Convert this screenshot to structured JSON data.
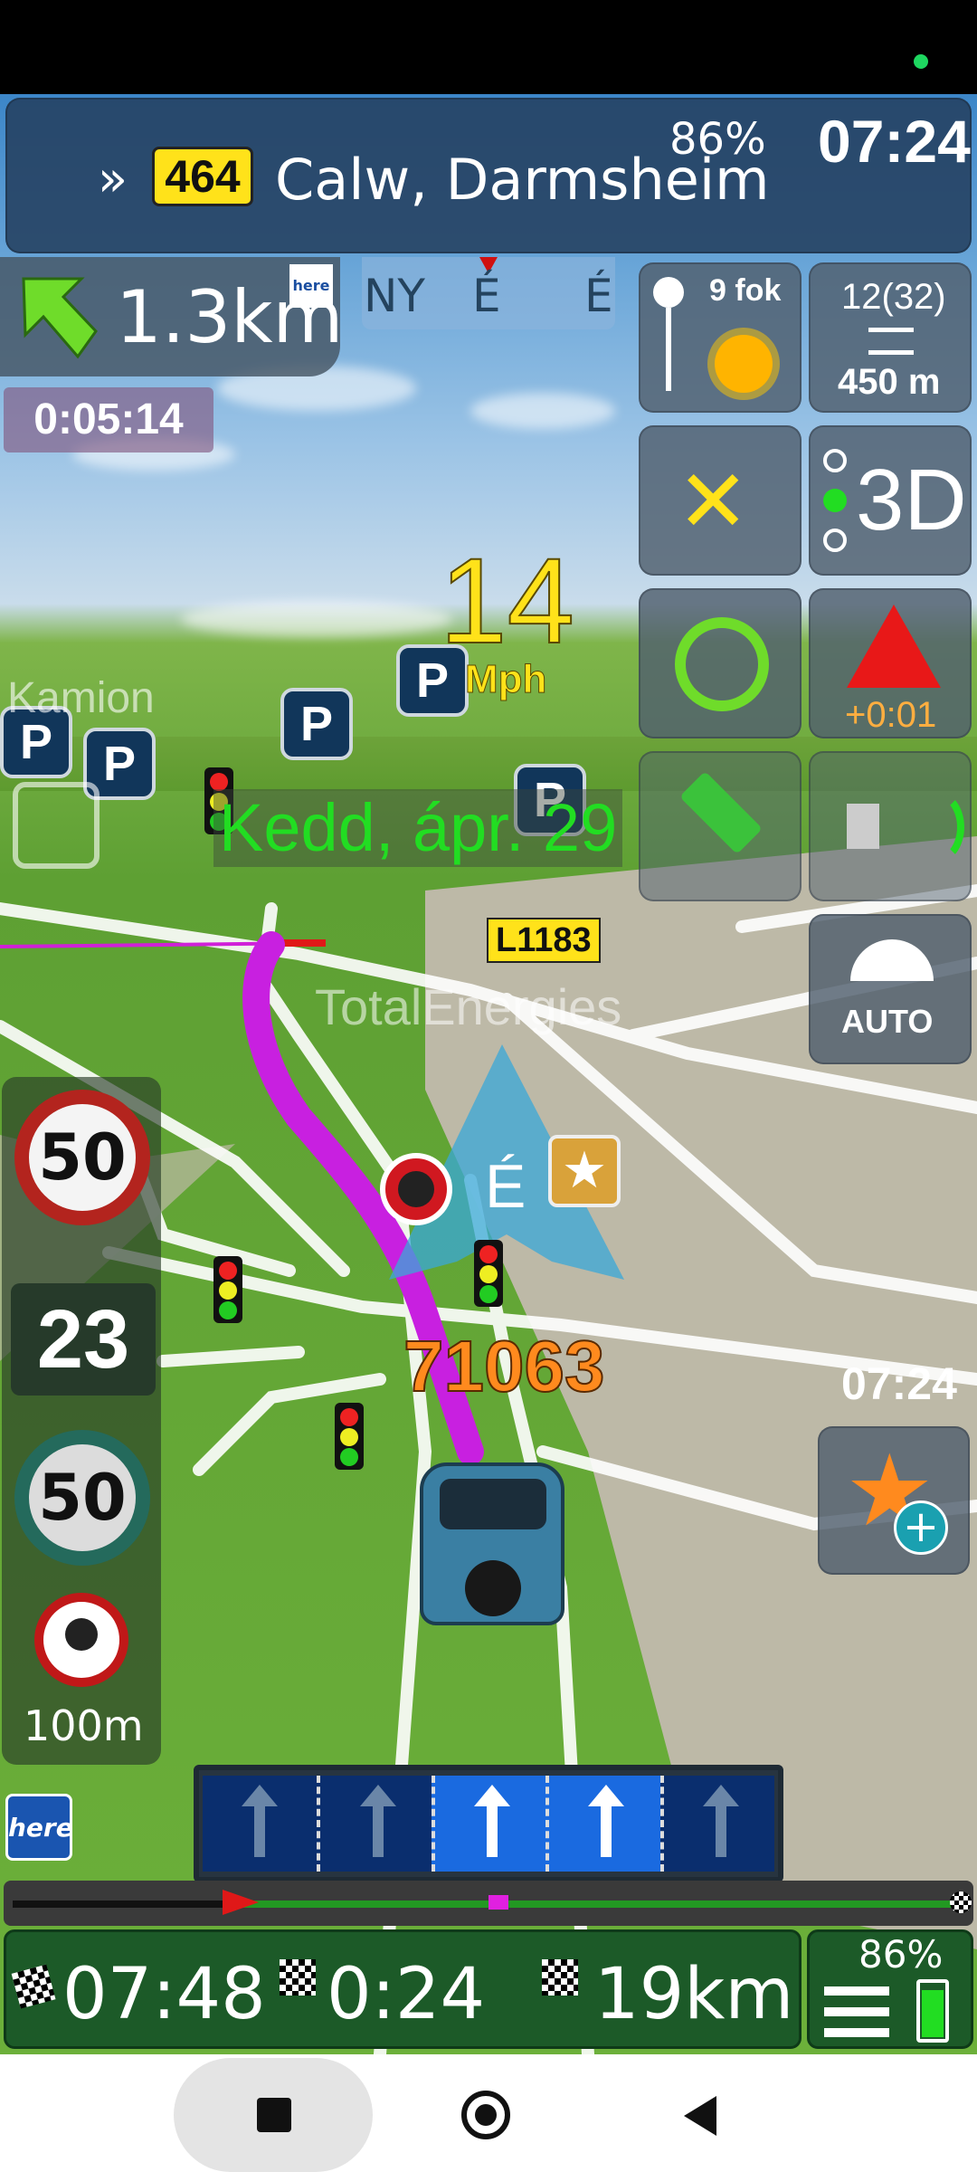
{
  "status_bar": {
    "indicator_color": "#1ed760"
  },
  "header": {
    "route_number": "464",
    "destination": "Calw, Darmsheim",
    "battery": "86%",
    "clock": "07:24"
  },
  "turn": {
    "distance": "1.3km",
    "provider_badge": "here"
  },
  "compass_strip": {
    "labels": [
      "NY",
      "É",
      "É"
    ]
  },
  "elapsed_time": "0:05:14",
  "weather": {
    "temperature": "9 fok"
  },
  "satellites": {
    "count": "12(32)",
    "altitude": "450 m"
  },
  "view_mode": {
    "label": "3D"
  },
  "hazard": {
    "delay": "+0:01"
  },
  "brightness": {
    "label": "AUTO"
  },
  "speed": {
    "value": "14",
    "unit": "Mph"
  },
  "map_labels": {
    "date": "Kedd, ápr. 29",
    "road_label": "L1183",
    "poi_label": "TotalEnergies",
    "truck_label": "Kamion",
    "heading_letter": "É",
    "house_number": "71063",
    "map_clock": "07:24"
  },
  "speed_panel": {
    "limit_1": "50",
    "current_speed": "23",
    "limit_2": "50",
    "camera_distance": "100m"
  },
  "provider_logo": "here",
  "lanes": {
    "count": 5,
    "active": [
      2,
      3
    ]
  },
  "progress": {
    "fraction": 0.48
  },
  "bottom_bar": {
    "eta": "07:48",
    "remaining_time": "0:24",
    "remaining_distance": "19km",
    "battery": "86%"
  },
  "colors": {
    "route": "#c820e0",
    "accent_green": "#22dd22",
    "speed_yellow": "#ffe21a",
    "house_orange": "#ff8a1e"
  }
}
